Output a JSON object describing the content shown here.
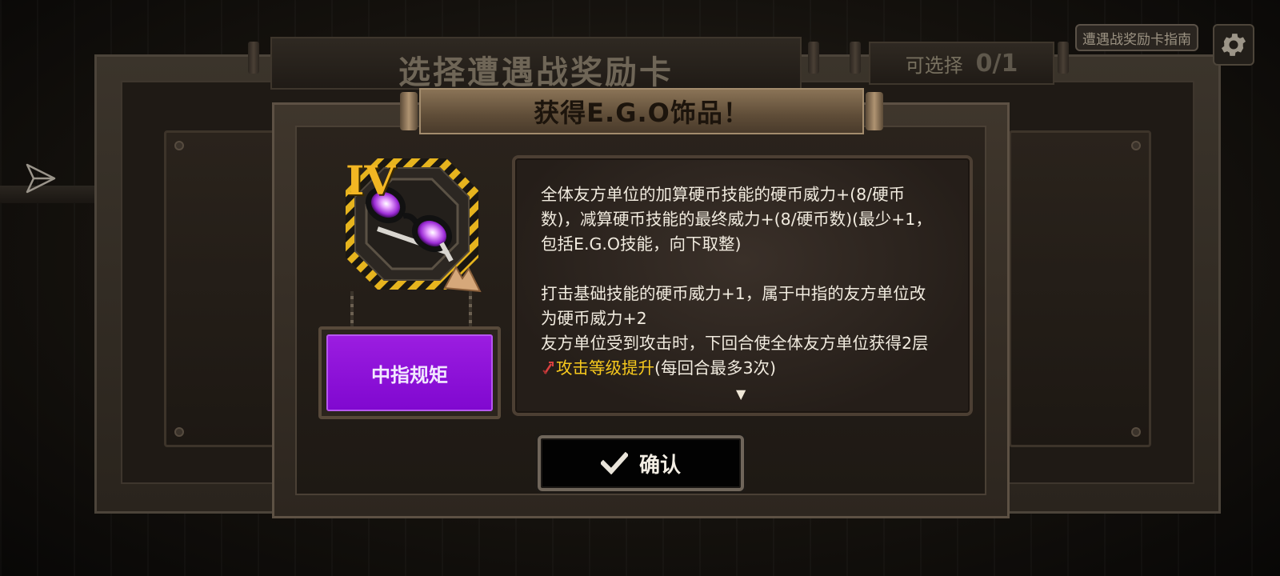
{
  "background": {
    "title": "选择遭遇战奖励卡",
    "select_label": "可选择",
    "select_count": "0/1"
  },
  "top_right": {
    "guide_label": "遭遇战奖励卡指南",
    "settings_icon": "gear-icon"
  },
  "left_side": {
    "share_icon": "send-arrow-icon"
  },
  "dialog": {
    "title": "获得E.G.O饰品！",
    "item": {
      "tier": "IV",
      "icon": "purple-sunglasses-icon",
      "name": "中指规矩",
      "name_plate_color": "#8f10d8"
    },
    "description": {
      "para1": "全体友方单位的加算硬币技能的硬币威力+(8/硬币数)，减算硬币技能的最终威力+(8/硬币数)(最少+1，包括E.G.O技能，向下取整)",
      "para2": "打击基础技能的硬币威力+1，属于中指的友方单位改为硬币威力+2",
      "para3_prefix": "友方单位受到攻击时，下回合使全体友方单位获得2层",
      "para3_keyword": "攻击等级提升",
      "para3_suffix": "(每回合最多3次)",
      "keyword_color": "#f7c91d",
      "keyword_icon": "attack-up-icon",
      "scroll_indicator": "▼"
    },
    "confirm_label": "确认",
    "confirm_icon": "checkmark-icon"
  }
}
